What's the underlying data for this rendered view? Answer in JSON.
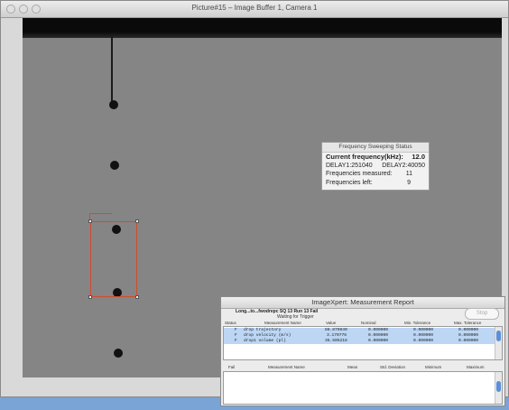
{
  "main_window": {
    "title": "Picture#15 – Image Buffer 1, Camera 1"
  },
  "status_panel": {
    "title": "Frequency Sweeping Status",
    "current_freq_label": "Current frequency(kHz):",
    "current_freq_value": "12.0",
    "delay1": "DELAY1:251040",
    "delay2": "DELAY2:40050",
    "measured_label": "Frequencies measured:",
    "measured_value": "11",
    "left_label": "Frequencies left:",
    "left_value": "9"
  },
  "report": {
    "title": "ImageXpert: Measurement Report",
    "file_name": "Long...to...fwodrepc SQ",
    "run_count": "13 Run",
    "fail_count": "13 Fail",
    "waiting_text": "Waiting for Trigger",
    "stop_label": "Stop",
    "columns": {
      "status": "Status",
      "name": "Measurement Name",
      "value": "Value",
      "nominal": "Nominal",
      "min_tol": "Min. Tolerance",
      "max_tol": "Max. Tolerance"
    },
    "rows": [
      {
        "status": "F",
        "name": "drop trajectory",
        "value": "88.870840",
        "nominal": "0.000000",
        "min_tol": "0.000000",
        "max_tol": "0.000000"
      },
      {
        "status": "F",
        "name": "drop velocity (m/s)",
        "value": "3.170776",
        "nominal": "0.000000",
        "min_tol": "0.000000",
        "max_tol": "0.000000"
      },
      {
        "status": "F",
        "name": "drop1 volume (pl)",
        "value": "35.505218",
        "nominal": "0.000000",
        "min_tol": "0.000000",
        "max_tol": "0.000000"
      }
    ],
    "stats_columns": {
      "fail": "Fail",
      "name": "Measurement Name",
      "mean": "Mean",
      "std": "Std. Deviation",
      "min": "Minimum",
      "max": "Maximum"
    }
  },
  "colors": {
    "roi": "#d24a2e",
    "selection": "#bcd6f4",
    "scroll_thumb": "#5b8fd9"
  }
}
